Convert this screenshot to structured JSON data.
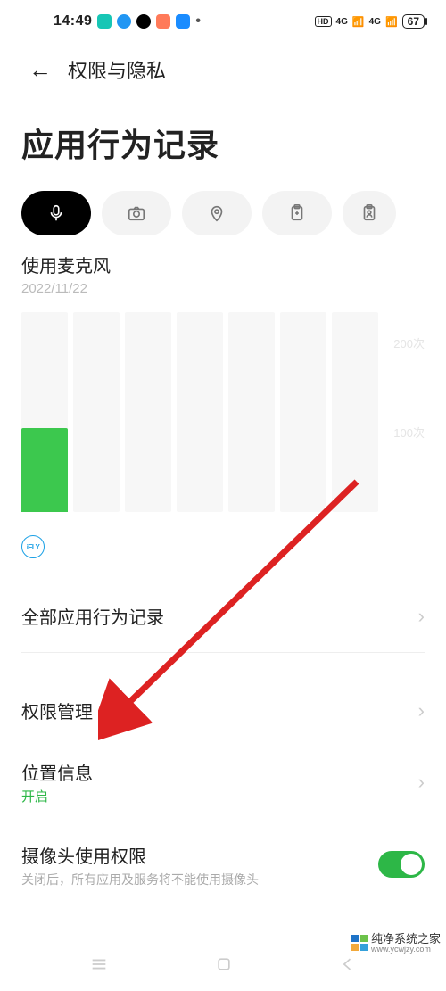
{
  "status": {
    "time": "14:49",
    "battery": "67",
    "hd_badge": "HD",
    "sig1": "4G",
    "sig2": "4G"
  },
  "header": {
    "title": "权限与隐私"
  },
  "page": {
    "title": "应用行为记录"
  },
  "filters": {
    "active_index": 0,
    "icons": [
      "microphone-icon",
      "camera-icon",
      "location-icon",
      "clipboard-icon",
      "contacts-icon"
    ]
  },
  "section": {
    "title": "使用麦克风",
    "date": "2022/11/22"
  },
  "chart_data": {
    "type": "bar",
    "categories": [
      "b1",
      "b2",
      "b3",
      "b4",
      "b5",
      "b6",
      "b7"
    ],
    "values": [
      100,
      0,
      0,
      0,
      0,
      0,
      0
    ],
    "ylim": [
      0,
      250
    ],
    "yticks": [
      100,
      200
    ],
    "ytick_labels": [
      "100次",
      "200次"
    ],
    "bar_color": "#3cc84e"
  },
  "app_badge": {
    "label": "iFLY"
  },
  "list": {
    "all_records": "全部应用行为记录",
    "permission_mgmt": "权限管理",
    "location": {
      "label": "位置信息",
      "status": "开启"
    },
    "camera_perm": {
      "label": "摄像头使用权限",
      "sub": "关闭后，所有应用及服务将不能使用摄像头",
      "toggle": true
    }
  },
  "watermark": {
    "line1": "纯净系统之家",
    "line2": "www.ycwjzy.com"
  }
}
